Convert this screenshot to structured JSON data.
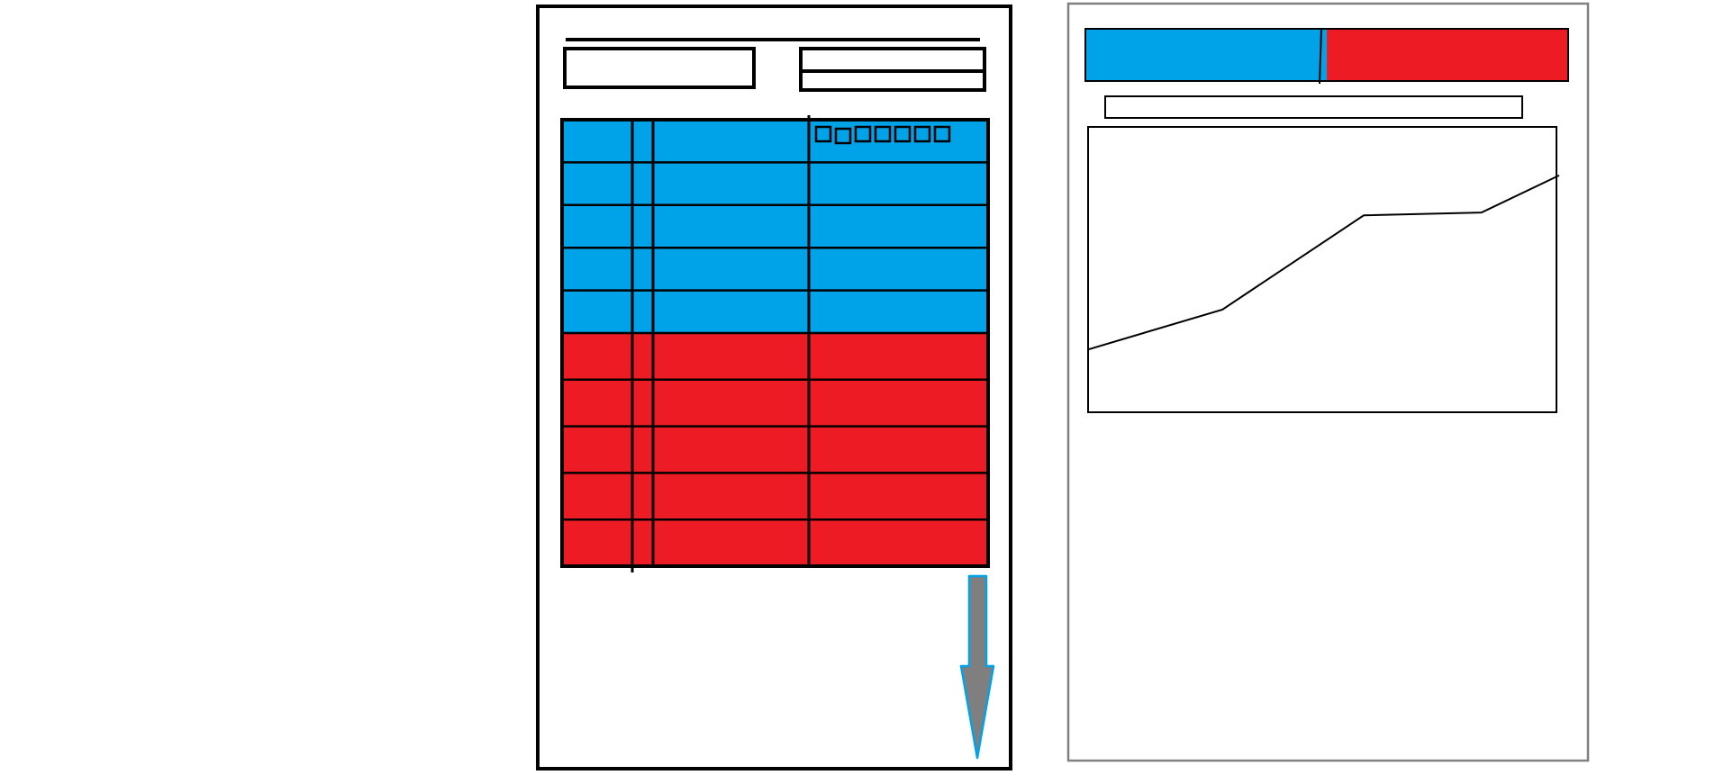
{
  "colors": {
    "background": "#ffffff",
    "blue": "#00A2E8",
    "red": "#ED1C24",
    "line": "#000000",
    "panel_border_right": "#808080",
    "arrow_fill": "#7F7F7F",
    "arrow_outline": "#00A2E8"
  },
  "left_panel": {
    "header_top_box": "",
    "header_right_split_box": "",
    "table": {
      "blue_rows": 5,
      "red_rows": 5,
      "columns": 4,
      "header_small_squares": 7
    },
    "scroll_arrow_icon": "arrow-down-icon"
  },
  "right_panel": {
    "progress_split": [
      {
        "name": "blue",
        "fraction": 0.5
      },
      {
        "name": "red",
        "fraction": 0.5
      }
    ],
    "input_bar": "",
    "chart_data": {
      "type": "line",
      "values": [
        0.22,
        0.36,
        0.69,
        0.7,
        0.83
      ],
      "title": "",
      "xlabel": "",
      "ylabel": ""
    }
  }
}
